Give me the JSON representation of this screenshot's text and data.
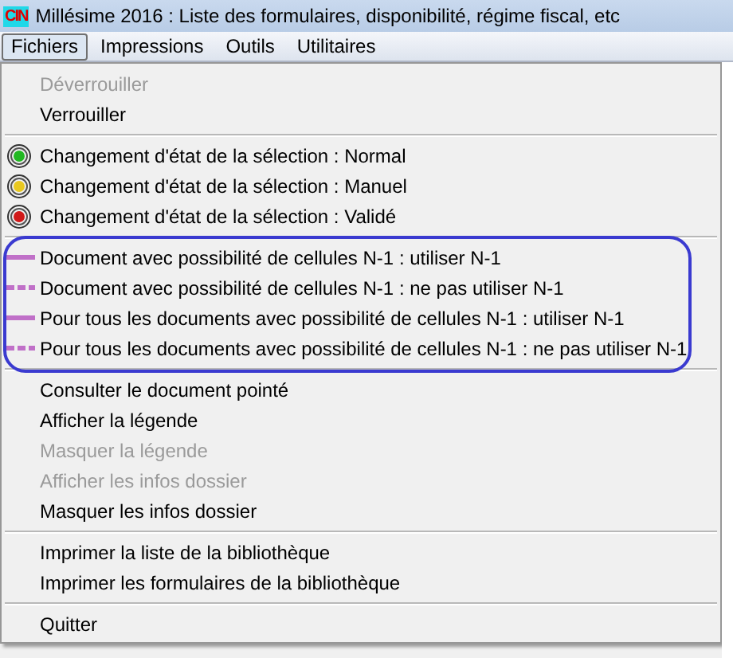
{
  "window": {
    "logo": "CIN",
    "title": "Millésime 2016 : Liste des formulaires, disponibilité, régime fiscal, etc"
  },
  "menubar": [
    {
      "label": "Fichiers",
      "selected": true
    },
    {
      "label": "Impressions",
      "selected": false
    },
    {
      "label": "Outils",
      "selected": false
    },
    {
      "label": "Utilitaires",
      "selected": false
    }
  ],
  "menu": {
    "sections": [
      {
        "annotated": false,
        "items": [
          {
            "kind": "plain",
            "label": "Déverrouiller",
            "disabled": true
          },
          {
            "kind": "plain",
            "label": "Verrouiller",
            "disabled": false
          }
        ]
      },
      {
        "annotated": false,
        "items": [
          {
            "kind": "status",
            "label": "Changement d'état de la sélection : Normal",
            "disabled": false,
            "color": "#22b822"
          },
          {
            "kind": "status",
            "label": "Changement d'état de la sélection : Manuel",
            "disabled": false,
            "color": "#e8c820"
          },
          {
            "kind": "status",
            "label": "Changement d'état de la sélection : Validé",
            "disabled": false,
            "color": "#d01818"
          }
        ]
      },
      {
        "annotated": true,
        "items": [
          {
            "kind": "solid-line",
            "label": "Document avec possibilité de cellules N-1 : utiliser N-1",
            "disabled": false
          },
          {
            "kind": "dashed-line",
            "label": "Document avec possibilité de cellules N-1 : ne pas utiliser N-1",
            "disabled": false
          },
          {
            "kind": "solid-line",
            "label": "Pour tous les documents avec possibilité de cellules N-1 : utiliser N-1",
            "disabled": false
          },
          {
            "kind": "dashed-line",
            "label": "Pour tous les documents avec possibilité de cellules N-1 : ne pas utiliser N-1",
            "disabled": false
          }
        ]
      },
      {
        "annotated": false,
        "items": [
          {
            "kind": "plain",
            "label": "Consulter le document pointé",
            "disabled": false
          },
          {
            "kind": "plain",
            "label": "Afficher la légende",
            "disabled": false
          },
          {
            "kind": "plain",
            "label": "Masquer la légende",
            "disabled": true
          },
          {
            "kind": "plain",
            "label": "Afficher les infos dossier",
            "disabled": true
          },
          {
            "kind": "plain",
            "label": "Masquer les infos dossier",
            "disabled": false
          }
        ]
      },
      {
        "annotated": false,
        "items": [
          {
            "kind": "plain",
            "label": "Imprimer la liste de la bibliothèque",
            "disabled": false
          },
          {
            "kind": "plain",
            "label": "Imprimer les formulaires de la bibliothèque",
            "disabled": false
          }
        ]
      },
      {
        "annotated": false,
        "items": [
          {
            "kind": "plain",
            "label": "Quitter",
            "disabled": false
          }
        ]
      }
    ]
  }
}
